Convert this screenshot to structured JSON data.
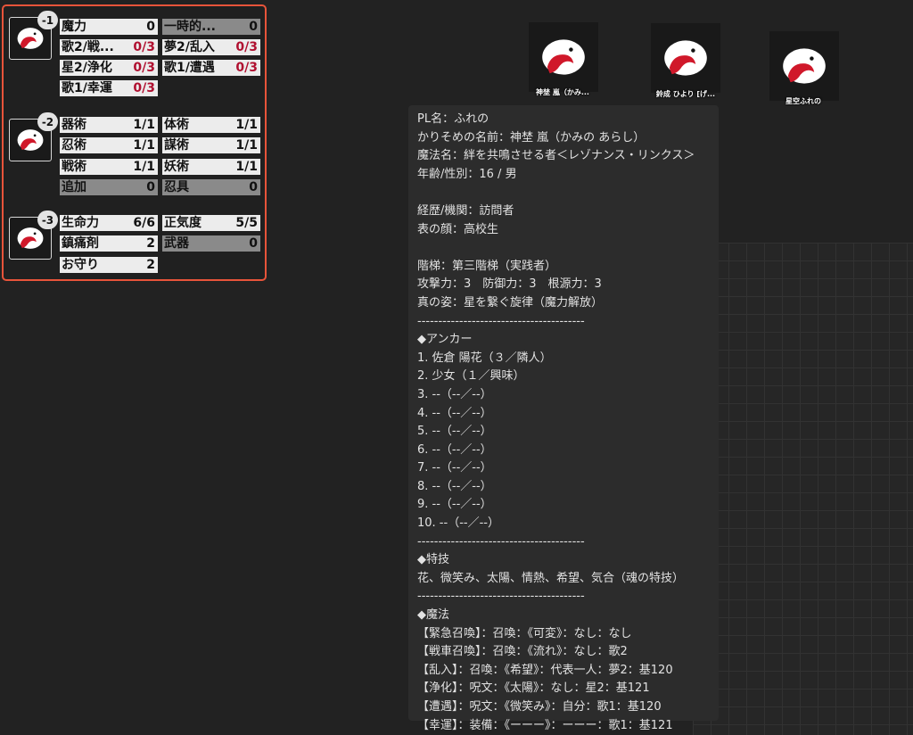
{
  "panel": {
    "groups": [
      {
        "badge": "-1",
        "stats": [
          {
            "name": "魔力",
            "value": "0",
            "bg": "light",
            "red": false
          },
          {
            "name": "一時的...",
            "value": "0",
            "bg": "dark",
            "red": false
          },
          {
            "name": "歌2/戦...",
            "value": "0/3",
            "bg": "light",
            "red": true
          },
          {
            "name": "夢2/乱入",
            "value": "0/3",
            "bg": "light",
            "red": true
          },
          {
            "name": "星2/浄化",
            "value": "0/3",
            "bg": "light",
            "red": true
          },
          {
            "name": "歌1/遭遇",
            "value": "0/3",
            "bg": "light",
            "red": true
          },
          {
            "name": "歌1/幸運",
            "value": "0/3",
            "bg": "light",
            "red": true
          }
        ]
      },
      {
        "badge": "-2",
        "stats": [
          {
            "name": "器術",
            "value": "1/1",
            "bg": "light",
            "red": false
          },
          {
            "name": "体術",
            "value": "1/1",
            "bg": "light",
            "red": false
          },
          {
            "name": "忍術",
            "value": "1/1",
            "bg": "light",
            "red": false
          },
          {
            "name": "謀術",
            "value": "1/1",
            "bg": "light",
            "red": false
          },
          {
            "name": "戦術",
            "value": "1/1",
            "bg": "light",
            "red": false
          },
          {
            "name": "妖術",
            "value": "1/1",
            "bg": "light",
            "red": false
          },
          {
            "name": "追加",
            "value": "0",
            "bg": "dark",
            "red": false
          },
          {
            "name": "忍具",
            "value": "0",
            "bg": "dark",
            "red": false
          }
        ]
      },
      {
        "badge": "-3",
        "stats": [
          {
            "name": "生命力",
            "value": "6/6",
            "bg": "light",
            "red": false
          },
          {
            "name": "正気度",
            "value": "5/5",
            "bg": "light",
            "red": false
          },
          {
            "name": "鎮痛剤",
            "value": "2",
            "bg": "light",
            "red": false
          },
          {
            "name": "武器",
            "value": "0",
            "bg": "dark",
            "red": false
          },
          {
            "name": "お守り",
            "value": "2",
            "bg": "light",
            "red": false
          }
        ]
      }
    ]
  },
  "tokens": [
    {
      "label": "神埜 嵐（かみ..."
    },
    {
      "label": "鈴成 ひより [げ..."
    },
    {
      "label": "星空ふれの"
    }
  ],
  "tooltip": {
    "lines": [
      "PL名：ふれの",
      "かりそめの名前：神埜 嵐（かみの あらし）",
      "魔法名：絆を共鳴させる者＜レゾナンス・リンクス＞",
      "年齢/性別：16 / 男",
      "",
      "経歴/機関：訪問者",
      "表の顔：高校生",
      "",
      "階梯：第三階梯（実践者）",
      "攻撃力：3　防御力：3　根源力：3",
      "真の姿：星を繋ぐ旋律（魔力解放）",
      "----------------------------------------",
      "◆アンカー",
      "1. 佐倉 陽花（３／隣人）",
      "2. 少女（１／興味）",
      "3. --（--／--）",
      "4. --（--／--）",
      "5. --（--／--）",
      "6. --（--／--）",
      "7. --（--／--）",
      "8. --（--／--）",
      "9. --（--／--）",
      "10. --（--／--）",
      "----------------------------------------",
      "◆特技",
      "花、微笑み、太陽、情熱、希望、気合（魂の特技）",
      "----------------------------------------",
      "◆魔法",
      "【緊急召喚】：召喚：《可変》：なし：なし",
      "【戦車召喚】：召喚：《流れ》：なし：歌2",
      "【乱入】：召喚：《希望》：代表一人：夢2：基120",
      "【浄化】：呪文：《太陽》：なし：星2：基121",
      "【遭遇】：呪文：《微笑み》：自分：歌1：基120",
      "【幸運】：装備：《ーーー》：ーーー：歌1：基121"
    ]
  },
  "colors": {
    "accent_border": "#e8543a",
    "counter_red": "#b01030",
    "background": "#222222"
  },
  "icons": {
    "avatar": "red-white-bird-icon"
  }
}
